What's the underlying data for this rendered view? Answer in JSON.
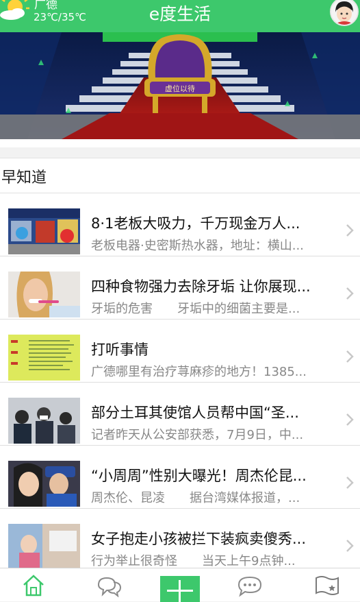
{
  "header": {
    "city": "广德",
    "temperature": "23℃/35℃",
    "title": "e度生活",
    "weather_icon": "sun-cloud-icon",
    "avatar_icon": "user-avatar-icon"
  },
  "banner": {
    "image_name": "throne-banner",
    "text": "虚位以待",
    "active_dot": 1,
    "dot_count": 2
  },
  "section": {
    "title": "早知道"
  },
  "news": [
    {
      "title": "8·1老板大吸力，千万现金万人...",
      "summary": "老板电器·史密斯热水器，地址：横山...",
      "thumb": "storefront-photo"
    },
    {
      "title": "四种食物强力去除牙垢 让你展现...",
      "summary": "牙垢的危害　　牙垢中的细菌主要是...",
      "thumb": "toothbrush-woman-photo"
    },
    {
      "title": "打听事情",
      "summary": "广德哪里有治疗荨麻疹的地方！1385...",
      "thumb": "yellow-notice-photo"
    },
    {
      "title": "部分土耳其使馆人员帮中国“圣...",
      "summary": "记者昨天从公安部获悉，7月9日，中...",
      "thumb": "airport-crowd-photo"
    },
    {
      "title": "“小周周”性别大曝光！周杰伦昆...",
      "summary": "周杰伦、昆凌　　据台湾媒体报道，...",
      "thumb": "couple-selfie-photo"
    },
    {
      "title": "女子抱走小孩被拦下装疯卖傻秀...",
      "summary": "行为举止很奇怪　　当天上午9点钟...",
      "thumb": "child-photo"
    }
  ],
  "tabbar": {
    "items": [
      {
        "icon": "home-icon",
        "active": true
      },
      {
        "icon": "chat-bubbles-icon",
        "active": false
      },
      {
        "icon": "plus-icon",
        "active": false
      },
      {
        "icon": "comment-dots-icon",
        "active": false
      },
      {
        "icon": "map-flag-icon",
        "active": false
      }
    ]
  },
  "colors": {
    "accent": "#3dc86c",
    "title_text": "#111111",
    "summary_text": "#888888"
  }
}
